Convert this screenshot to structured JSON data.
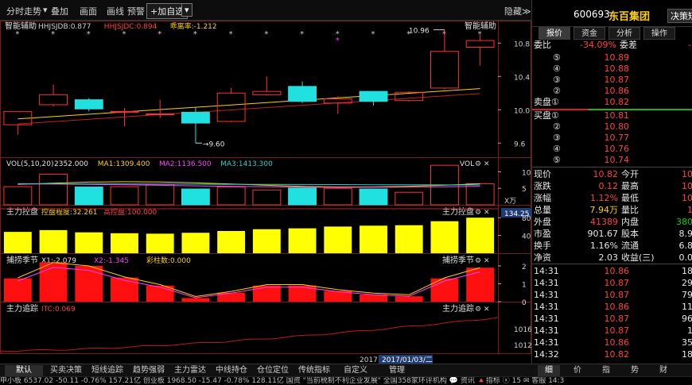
{
  "toolbar": {
    "items": [
      "分时走势",
      "叠加",
      "画面",
      "画线",
      "预警",
      "+加自选"
    ],
    "hide_label": "隐藏≫"
  },
  "main_chart": {
    "title": "智能辅助",
    "right_title": "智能辅助",
    "indicators": [
      {
        "text": "HHJSJDB:0.877",
        "color": "#d0d0d0"
      },
      {
        "text": "HHJSJDC:0.894",
        "color": "#ff4040"
      },
      {
        "text": "乖离率:-1.212",
        "color": "#ffd000"
      }
    ],
    "ticks": [
      "10.8",
      "10.4",
      "10.0",
      "9.6"
    ],
    "high_label": "10.96",
    "low_label": "9.60",
    "candles": [
      {
        "o": 9.82,
        "c": 9.98,
        "h": 9.98,
        "l": 9.7
      },
      {
        "o": 10.06,
        "c": 10.18,
        "h": 10.3,
        "l": 10.04
      },
      {
        "o": 10.12,
        "c": 10.01,
        "h": 10.14,
        "l": 9.98
      },
      {
        "o": 9.98,
        "c": 9.98,
        "h": 10.02,
        "l": 9.8
      },
      {
        "o": 9.95,
        "c": 9.95,
        "h": 10.12,
        "l": 9.9
      },
      {
        "o": 9.97,
        "c": 9.84,
        "h": 10.03,
        "l": 9.6
      },
      {
        "o": 9.86,
        "c": 10.2,
        "h": 10.26,
        "l": 9.85
      },
      {
        "o": 10.18,
        "c": 10.22,
        "h": 10.4,
        "l": 10.17
      },
      {
        "o": 10.28,
        "c": 10.1,
        "h": 10.34,
        "l": 10.08
      },
      {
        "o": 10.08,
        "c": 10.13,
        "h": 10.16,
        "l": 9.95
      },
      {
        "o": 10.22,
        "c": 10.1,
        "h": 10.22,
        "l": 10.05
      },
      {
        "o": 10.11,
        "c": 10.21,
        "h": 10.22,
        "l": 10.1
      },
      {
        "o": 10.26,
        "c": 10.7,
        "h": 10.96,
        "l": 10.24
      },
      {
        "o": 10.75,
        "c": 10.83,
        "h": 10.9,
        "l": 10.53
      }
    ]
  },
  "vol_panel": {
    "title": "VOL(5,10,20)",
    "items": [
      {
        "text": "2352.000",
        "color": "#e6e6e6"
      },
      {
        "text": "MA1:1309.400",
        "color": "#ffd000"
      },
      {
        "text": "MA2:1136.500",
        "color": "#ff40ff"
      },
      {
        "text": "MA3:1413.300",
        "color": "#20d0d0"
      }
    ],
    "right_label": "VOL",
    "ticks": [
      "10",
      "5"
    ],
    "unit_label": "X万",
    "values": [
      5.5,
      9.3,
      5.4,
      5.5,
      6.2,
      4.8,
      5.4,
      4.5,
      5.1,
      5.0,
      4.8,
      3.8,
      12.0,
      6.4
    ]
  },
  "zhuli_panel": {
    "title": "主力控盘",
    "items": [
      {
        "text": "控盘程度:32.261",
        "color": "#ffd000"
      },
      {
        "text": "高控盘:100.000",
        "color": "#ff4040"
      }
    ],
    "right_label": "主力控盘",
    "value_box": "134.25",
    "ticks": [
      "80",
      "40"
    ],
    "values": [
      48,
      52,
      47,
      45,
      44,
      46,
      50,
      54,
      56,
      60,
      62,
      63,
      72,
      80
    ]
  },
  "bujie_panel": {
    "title": "捕捞季节",
    "items": [
      {
        "text": "X1:-2.079",
        "color": "#e6e6e6"
      },
      {
        "text": "X2:-1.345",
        "color": "#ff40ff"
      },
      {
        "text": "彩柱数:0.000",
        "color": "#ffd000"
      }
    ],
    "right_label": "捕捞季节",
    "ticks": [
      "2",
      "1",
      "0"
    ],
    "values": [
      1.3,
      2.2,
      2.0,
      1.35,
      0.9,
      0.2,
      0.5,
      0.9,
      0.9,
      0.6,
      0.4,
      0.3,
      1.3,
      1.9
    ]
  },
  "zhuizong_panel": {
    "title": "主力追踪",
    "items": [
      {
        "text": "ITC:0.069",
        "color": "#ff4040"
      }
    ],
    "right_label": "主力追踪",
    "ticks": [
      "1016",
      "1012"
    ]
  },
  "date_label": "2017/01/03/二",
  "year_partial": "2017",
  "bottom_tabs": [
    "默认",
    "买卖决策",
    "短线追踪",
    "趋势强弱",
    "主力雷达",
    "中线持仓",
    "仓位定位",
    "传统指标",
    "自定义",
    "管理"
  ],
  "stock": {
    "code": "600693",
    "name": "东百集团",
    "action": "决策短"
  },
  "rp_tabs": [
    "报价",
    "资金",
    "分析",
    "操作"
  ],
  "weibi": {
    "label": "委比",
    "value": "-34.09%",
    "label2": "委差",
    "value2": "-"
  },
  "asks": [
    {
      "n": "⑤",
      "p": "10.89",
      "v": ""
    },
    {
      "n": "④",
      "p": "10.88",
      "v": ""
    },
    {
      "n": "③",
      "p": "10.87",
      "v": ""
    },
    {
      "n": "②",
      "p": "10.86",
      "v": ""
    },
    {
      "n": "卖盘①",
      "p": "10.82",
      "v": ""
    }
  ],
  "bids": [
    {
      "n": "买盘①",
      "p": "10.81",
      "v": ""
    },
    {
      "n": "②",
      "p": "10.80",
      "v": ""
    },
    {
      "n": "③",
      "p": "10.77",
      "v": ""
    },
    {
      "n": "④",
      "p": "10.76",
      "v": ""
    },
    {
      "n": "⑤",
      "p": "10.74",
      "v": ""
    }
  ],
  "quote": [
    {
      "l1": "现价",
      "v1": "10.82",
      "c1": "red",
      "l2": "今开",
      "v2": "10",
      "c2": "red"
    },
    {
      "l1": "涨跌",
      "v1": "0.12",
      "c1": "red",
      "l2": "最高",
      "v2": "10",
      "c2": "red"
    },
    {
      "l1": "涨幅",
      "v1": "1.12%",
      "c1": "red",
      "l2": "最低",
      "v2": "10",
      "c2": "red"
    },
    {
      "l1": "总量",
      "v1": "7.94万",
      "c1": "yel",
      "l2": "量比",
      "v2": "1",
      "c2": "red"
    },
    {
      "l1": "外盘",
      "v1": "41389",
      "c1": "red",
      "l2": "内盘",
      "v2": "380",
      "c2": "grn"
    },
    {
      "l1": "市盈",
      "v1": "901.67",
      "c1": "wht",
      "l2": "股本",
      "v2": "8.9",
      "c2": "wht"
    },
    {
      "l1": "换手",
      "v1": "1.16%",
      "c1": "wht",
      "l2": "流通",
      "v2": "6.8",
      "c2": "wht"
    },
    {
      "l1": "净资",
      "v1": "2.03",
      "c1": "wht",
      "l2": "收益(三)",
      "v2": "0.0",
      "c2": "wht"
    }
  ],
  "ticks_list": [
    {
      "t": "14:31",
      "p": "10.86",
      "v": "18"
    },
    {
      "t": "14:31",
      "p": "10.87",
      "v": "29"
    },
    {
      "t": "14:31",
      "p": "10.87",
      "v": "79"
    },
    {
      "t": "14:31",
      "p": "10.86",
      "v": "11"
    },
    {
      "t": "14:31",
      "p": "10.87",
      "v": "96"
    },
    {
      "t": "14:31",
      "p": "10.87",
      "v": "1"
    },
    {
      "t": "14:31",
      "p": "10.86",
      "v": "35"
    },
    {
      "t": "14:32",
      "p": "10.82",
      "v": "18"
    }
  ],
  "rp_bottom_tabs": [
    "细",
    "价",
    "指",
    "势",
    "财"
  ],
  "ticker": "申小板 6537.02 -50.11 -0.76% 157.21亿   创业板 1968.50 -15.47 -0.78% 128.11亿   国资 \"当前税制不利企业发展\"   全国358家环评机构   💬 资讯   🔺指标   ⓧ 15  ✉ 客服  14:3"
}
